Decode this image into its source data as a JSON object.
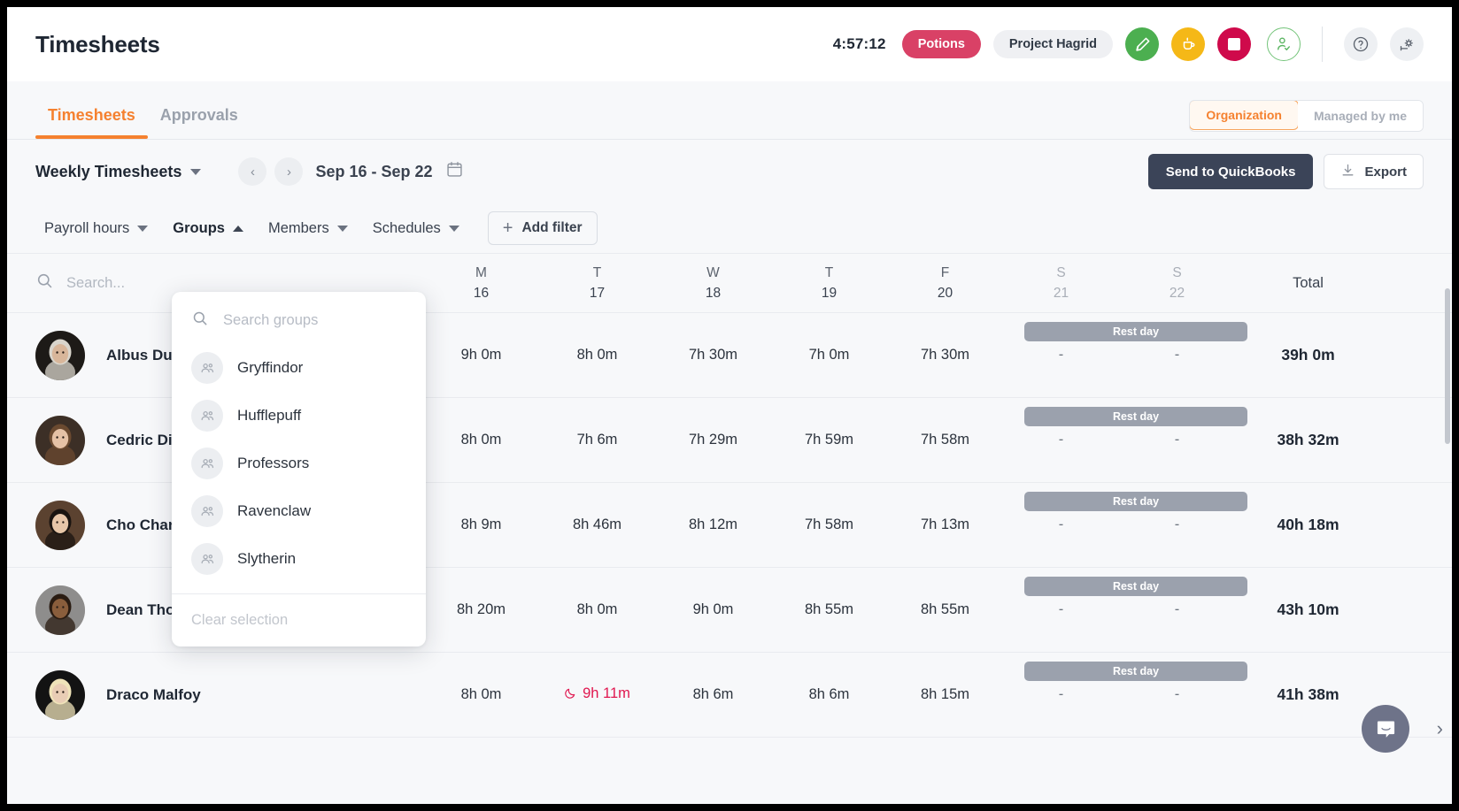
{
  "header": {
    "title": "Timesheets",
    "timer": "4:57:12",
    "task_badge": "Potions",
    "project_badge": "Project Hagrid",
    "icons": {
      "edit": "edit-pencil-icon",
      "break": "coffee-cup-icon",
      "stop": "stop-square-icon",
      "attendance": "person-check-icon",
      "help": "help-circle-icon",
      "settings": "gear-settings-icon"
    },
    "colors": {
      "task_badge": "#d94166",
      "green": "#4caf50",
      "amber": "#f5b817",
      "crimson": "#cf0a4b"
    }
  },
  "tabs": [
    {
      "label": "Timesheets",
      "active": true
    },
    {
      "label": "Approvals",
      "active": false
    }
  ],
  "scope_toggle": {
    "options": [
      "Organization",
      "Managed by me"
    ],
    "selected": "Organization"
  },
  "toolbar": {
    "view_selector": "Weekly Timesheets",
    "prev_label": "‹",
    "next_label": "›",
    "date_range": "Sep 16 - Sep 22",
    "calendar_icon": "calendar-icon",
    "quickbooks_label": "Send to QuickBooks",
    "export_label": "Export",
    "export_icon": "download-icon"
  },
  "filters": [
    {
      "label": "Payroll hours",
      "state": "closed",
      "active": false
    },
    {
      "label": "Groups",
      "state": "open",
      "active": true
    },
    {
      "label": "Members",
      "state": "closed",
      "active": false
    },
    {
      "label": "Schedules",
      "state": "closed",
      "active": false
    }
  ],
  "add_filter_label": "Add filter",
  "groups_dropdown": {
    "search_placeholder": "Search groups",
    "search_icon": "search-icon",
    "items": [
      {
        "label": "Gryffindor"
      },
      {
        "label": "Hufflepuff"
      },
      {
        "label": "Professors"
      },
      {
        "label": "Ravenclaw"
      },
      {
        "label": "Slytherin"
      }
    ],
    "clear_label": "Clear selection"
  },
  "table": {
    "search_placeholder": "Search...",
    "search_icon": "search-icon",
    "day_columns": [
      {
        "letter": "M",
        "num": "16",
        "weekend": false
      },
      {
        "letter": "T",
        "num": "17",
        "weekend": false
      },
      {
        "letter": "W",
        "num": "18",
        "weekend": false
      },
      {
        "letter": "T",
        "num": "19",
        "weekend": false
      },
      {
        "letter": "F",
        "num": "20",
        "weekend": false
      },
      {
        "letter": "S",
        "num": "21",
        "weekend": true
      },
      {
        "letter": "S",
        "num": "22",
        "weekend": true
      }
    ],
    "total_header": "Total",
    "rest_day_label": "Rest day",
    "rows": [
      {
        "name": "Albus Dumbledore",
        "avatar": "avatar-albus",
        "days": [
          {
            "value": "9h 0m"
          },
          {
            "value": "8h 0m"
          },
          {
            "value": "7h 30m"
          },
          {
            "value": "7h 0m"
          },
          {
            "value": "7h 30m"
          },
          {
            "value": "-"
          },
          {
            "value": "-"
          }
        ],
        "total": "39h 0m",
        "rest_day": true
      },
      {
        "name": "Cedric Diggory",
        "avatar": "avatar-cedric",
        "days": [
          {
            "value": "8h 0m"
          },
          {
            "value": "7h 6m"
          },
          {
            "value": "7h 29m"
          },
          {
            "value": "7h 59m"
          },
          {
            "value": "7h 58m"
          },
          {
            "value": "-"
          },
          {
            "value": "-"
          }
        ],
        "total": "38h 32m",
        "rest_day": true
      },
      {
        "name": "Cho Chang",
        "avatar": "avatar-cho",
        "days": [
          {
            "value": "8h 9m"
          },
          {
            "value": "8h 46m"
          },
          {
            "value": "8h 12m"
          },
          {
            "value": "7h 58m"
          },
          {
            "value": "7h 13m"
          },
          {
            "value": "-"
          },
          {
            "value": "-"
          }
        ],
        "total": "40h 18m",
        "rest_day": true
      },
      {
        "name": "Dean Thomas",
        "avatar": "avatar-dean",
        "days": [
          {
            "value": "8h 20m"
          },
          {
            "value": "8h 0m"
          },
          {
            "value": "9h 0m"
          },
          {
            "value": "8h 55m"
          },
          {
            "value": "8h 55m"
          },
          {
            "value": "-"
          },
          {
            "value": "-"
          }
        ],
        "total": "43h 10m",
        "rest_day": true
      },
      {
        "name": "Draco Malfoy",
        "avatar": "avatar-draco",
        "days": [
          {
            "value": "8h 0m"
          },
          {
            "value": "9h 11m",
            "flag": "overtime",
            "icon": "moon-icon"
          },
          {
            "value": "8h 6m"
          },
          {
            "value": "8h 6m"
          },
          {
            "value": "8h 15m"
          },
          {
            "value": "-"
          },
          {
            "value": "-"
          }
        ],
        "total": "41h 38m",
        "rest_day": true
      }
    ]
  },
  "overlays": {
    "chat_icon": "chat-bubble-icon",
    "next_chevron": "chevron-right-icon"
  }
}
